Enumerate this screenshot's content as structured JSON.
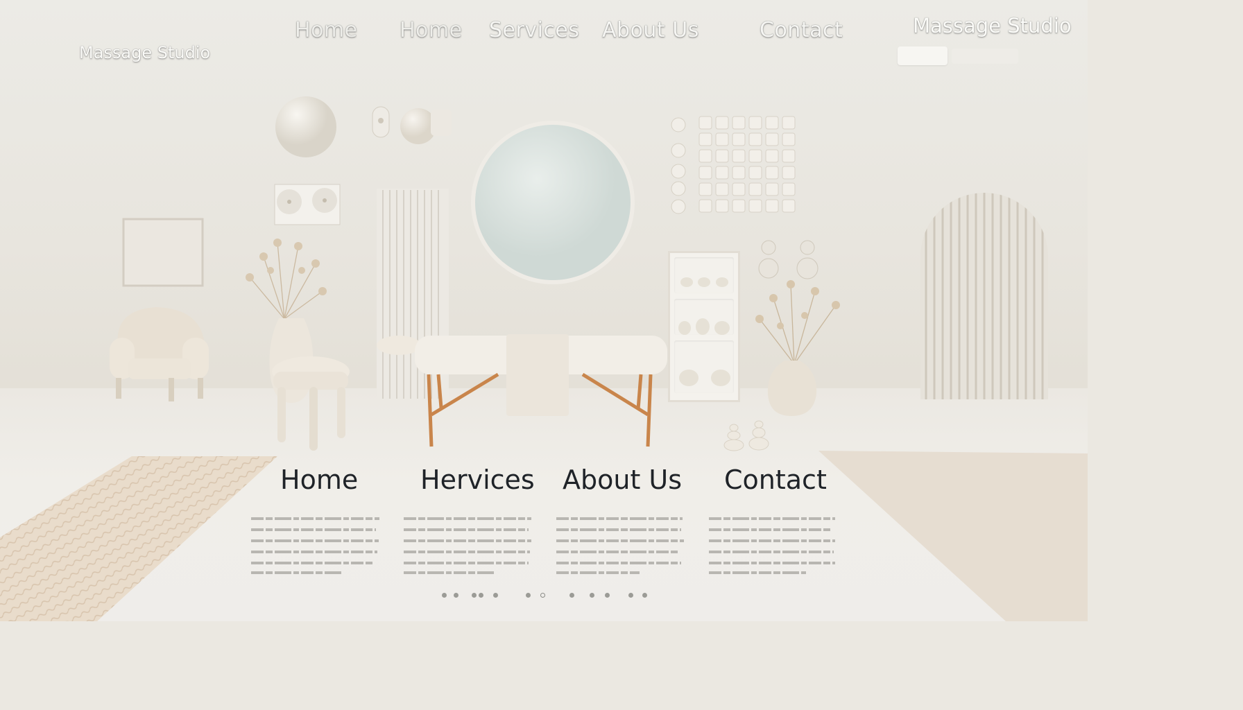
{
  "brand": {
    "left_logo": "Massage Studio",
    "right_logo": "Massage Studio"
  },
  "nav": [
    "Home",
    "Home",
    "Services",
    "About Us",
    "Contact"
  ],
  "search": {
    "placeholder": "",
    "button_label": ""
  },
  "sections": [
    {
      "title": "Home"
    },
    {
      "title": "Hervices"
    },
    {
      "title": "About Us"
    },
    {
      "title": "Contact"
    }
  ],
  "pagination": {
    "dot_count": 12,
    "active_index": 9
  },
  "colors": {
    "wall": "#ecebe6",
    "floor": "#efedea",
    "accent_wood": "#c9854b",
    "mirror": "#dfe6e2",
    "text_dark": "#1f2328"
  },
  "icons": [
    "vase-icon",
    "plant-icon",
    "mirror-icon",
    "shelf-icon",
    "stones-icon"
  ]
}
